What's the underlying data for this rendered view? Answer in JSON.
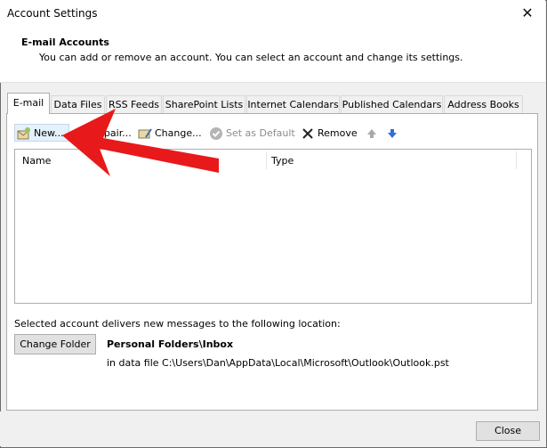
{
  "window": {
    "title": "Account Settings",
    "close_glyph": "✕"
  },
  "header": {
    "title": "E-mail Accounts",
    "subtitle": "You can add or remove an account. You can select an account and change its settings."
  },
  "tabs": [
    {
      "label": "E-mail",
      "active": true
    },
    {
      "label": "Data Files"
    },
    {
      "label": "RSS Feeds"
    },
    {
      "label": "SharePoint Lists"
    },
    {
      "label": "Internet Calendars"
    },
    {
      "label": "Published Calendars"
    },
    {
      "label": "Address Books"
    }
  ],
  "toolbar": {
    "new_label": "New...",
    "repair_label": "Repair...",
    "change_label": "Change...",
    "set_default_label": "Set as Default",
    "remove_label": "Remove",
    "up_icon": "arrow-up-icon",
    "down_icon": "arrow-down-icon"
  },
  "account_list": {
    "columns": [
      "Name",
      "Type"
    ],
    "rows": []
  },
  "delivery": {
    "text": "Selected account delivers new messages to the following location:",
    "change_folder_label": "Change Folder",
    "folder_name": "Personal Folders\\Inbox",
    "folder_path": "in data file C:\\Users\\Dan\\AppData\\Local\\Microsoft\\Outlook\\Outlook.pst"
  },
  "footer": {
    "close_label": "Close"
  },
  "colors": {
    "annotation_arrow": "#e8191a",
    "accent": "#0078d7"
  }
}
